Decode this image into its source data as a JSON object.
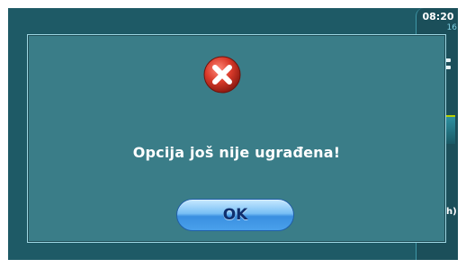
{
  "status": {
    "time": "08:20",
    "date": "16"
  },
  "side": {
    "label": "h)"
  },
  "dialog": {
    "icon": "error-x-icon",
    "message": "Opcija još nije ugrađena!",
    "ok_label": "OK"
  },
  "colors": {
    "background": "#1e5a66",
    "dialog": "#3a7d88",
    "error_red": "#d93a2a",
    "button_blue": "#4aa1ec"
  }
}
